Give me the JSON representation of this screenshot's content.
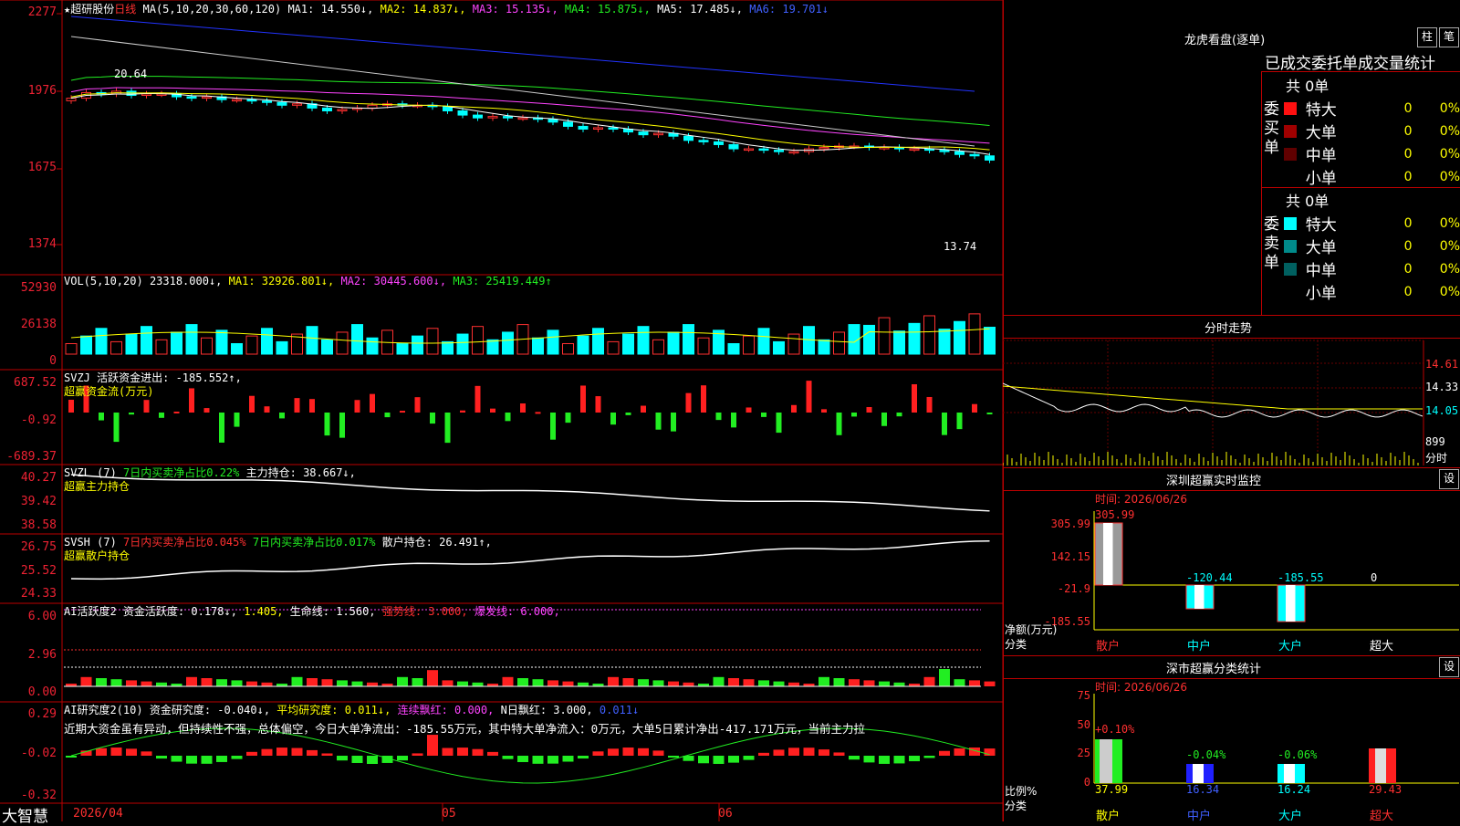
{
  "header": {
    "star": "★",
    "stock_name": "超研股份",
    "period": "日线",
    "ma_params": "MA(5,10,20,30,60,120)",
    "ma1": "MA1: 14.550↓,",
    "ma2": "MA2: 14.837↓,",
    "ma3": "MA3: 15.135↓,",
    "ma4": "MA4: 15.875↓,",
    "ma5": "MA5: 17.485↓,",
    "ma6": "MA6: 19.701↓"
  },
  "price_axis": [
    "2277",
    "1976",
    "1675",
    "1374"
  ],
  "price_labels": {
    "high": "20.64",
    "low": "13.74"
  },
  "vol": {
    "title": "VOL(5,10,20)",
    "value": "23318.000↓,",
    "ma1": "MA1: 32926.801↓,",
    "ma2": "MA2: 30445.600↓,",
    "ma3": "MA3: 25419.449↑",
    "axis": [
      "52930",
      "26138",
      "0"
    ]
  },
  "svzj": {
    "title": "SVZJ  活跃资金进出: -185.552↑,",
    "subtitle": "超赢资金流(万元)",
    "axis": [
      "687.52",
      "-0.92",
      "-689.37"
    ]
  },
  "svzl": {
    "title": "SVZL (7)",
    "t2": "7日内买卖净占比0.22%",
    "t3": "主力持仓: 38.667↓,",
    "subtitle": "超赢主力持仓",
    "axis": [
      "40.27",
      "39.42",
      "38.58"
    ]
  },
  "svsh": {
    "title": "SVSH (7)",
    "t2": "7日内买卖净占比0.045%",
    "t3": "7日内买卖净占比0.017%",
    "t4": "散户持仓: 26.491↑,",
    "subtitle": "超赢散户持仓",
    "axis": [
      "26.75",
      "25.52",
      "24.33"
    ]
  },
  "ai1": {
    "title": "AI活跃度2",
    "t2": "资金活跃度: 0.178↓,",
    "t3": "1.405,",
    "t4": "生命线: 1.560,",
    "t5": "强势线: 3.000,",
    "t6": "爆发线: 6.000,",
    "axis": [
      "6.00",
      "2.96",
      "0.00"
    ]
  },
  "ai2": {
    "title": "AI研究度2(10)",
    "t2": "资金研究度: -0.040↓,",
    "t3": "平均研究度: 0.011↓,",
    "t4": "连续飘红: 0.000,",
    "t5": "N日飘红: 3.000,",
    "t6": "0.011↓",
    "note": "近期大资金虽有异动，但持续性不强，总体偏空，今日大单净流出：-185.55万元，其中特大单净流入：0万元，大单5日累计净出-417.171万元，当前主力拉",
    "axis": [
      "0.29",
      "-0.02",
      "-0.32"
    ]
  },
  "bottom": {
    "brand": "大智慧",
    "dates": [
      "2026/04",
      "05",
      "06"
    ]
  },
  "right": {
    "dragon_title": "龙虎看盘(逐单)",
    "btn_bar": "柱",
    "btn_pen": "笔",
    "tabs_text": "已成交委托单成交量统计",
    "buy_label": "委买单",
    "sell_label": "委卖单",
    "buy_total": "共 0单",
    "sell_total": "共 0单",
    "buy_rows": [
      {
        "name": "特大",
        "count": "0",
        "pct": "0%",
        "color": "#ff1010"
      },
      {
        "name": "大单",
        "count": "0",
        "pct": "0%",
        "color": "#a00000"
      },
      {
        "name": "中单",
        "count": "0",
        "pct": "0%",
        "color": "#600000"
      },
      {
        "name": "小单",
        "count": "0",
        "pct": "0%",
        "color": "#000000"
      }
    ],
    "sell_rows": [
      {
        "name": "特大",
        "count": "0",
        "pct": "0%",
        "color": "#00ffff"
      },
      {
        "name": "大单",
        "count": "0",
        "pct": "0%",
        "color": "#008a8a"
      },
      {
        "name": "中单",
        "count": "0",
        "pct": "0%",
        "color": "#006060"
      },
      {
        "name": "小单",
        "count": "0",
        "pct": "0%",
        "color": "#000000"
      }
    ],
    "intraday_title": "分时走势",
    "intraday_axis": [
      "14.61",
      "14.33",
      "14.05",
      "899",
      "分时"
    ],
    "monitor_title": "深圳超赢实时监控",
    "monitor_btn": "设",
    "monitor_time": "时间: 2026/06/26",
    "monitor_axis": [
      "305.99",
      "142.15",
      "-21.9",
      "-185.55"
    ],
    "monitor_values": {
      "retail": "305.99",
      "mid": "-120.44",
      "big": "-185.55",
      "super": "0"
    },
    "monitor_ylabel": "净额(万元)",
    "monitor_xlabel": "分类",
    "cats": [
      "散户",
      "中户",
      "大户",
      "超大"
    ],
    "class_title": "深市超赢分类统计",
    "class_btn": "设",
    "class_time": "时间: 2026/06/26",
    "class_axis": [
      "75",
      "50",
      "25",
      "0"
    ],
    "class_changes": [
      "+0.10%",
      "-0.04%",
      "-0.06%"
    ],
    "class_values": [
      "37.99",
      "16.34",
      "16.24",
      "29.43"
    ],
    "class_ylabel": "比例%",
    "class_xlabel": "分类"
  },
  "chart_data": {
    "type": "candlestick",
    "title": "超研股份 日线",
    "price_range": [
      13.74,
      20.64
    ],
    "ma": {
      "MA1": 14.55,
      "MA2": 14.837,
      "MA3": 15.135,
      "MA4": 15.875,
      "MA5": 17.485,
      "MA6": 19.701
    },
    "volume_range": [
      0,
      52930
    ],
    "last_volume": 23318.0,
    "fund_flow_range": [
      -689.37,
      687.52
    ],
    "monitor": {
      "categories": [
        "散户",
        "中户",
        "大户",
        "超大"
      ],
      "values": [
        305.99,
        -120.44,
        -185.55,
        0
      ]
    },
    "class_ratio": {
      "categories": [
        "散户",
        "中户",
        "大户",
        "超大"
      ],
      "values": [
        37.99,
        16.34,
        16.24,
        29.43
      ]
    }
  }
}
